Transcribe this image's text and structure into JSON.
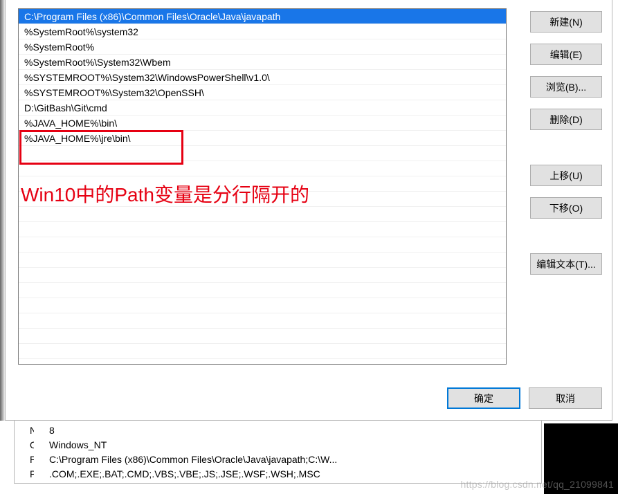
{
  "pathList": {
    "items": [
      "C:\\Program Files (x86)\\Common Files\\Oracle\\Java\\javapath",
      "%SystemRoot%\\system32",
      "%SystemRoot%",
      "%SystemRoot%\\System32\\Wbem",
      "%SYSTEMROOT%\\System32\\WindowsPowerShell\\v1.0\\",
      "%SYSTEMROOT%\\System32\\OpenSSH\\",
      "D:\\GitBash\\Git\\cmd",
      "%JAVA_HOME%\\bin\\",
      "%JAVA_HOME%\\jre\\bin\\"
    ],
    "selectedIndex": 0
  },
  "buttons": {
    "new": "新建(N)",
    "edit": "编辑(E)",
    "browse": "浏览(B)...",
    "delete": "删除(D)",
    "moveUp": "上移(U)",
    "moveDown": "下移(O)",
    "editText": "编辑文本(T)...",
    "ok": "确定",
    "cancel": "取消"
  },
  "annotation": {
    "text": "Win10中的Path变量是分行隔开的"
  },
  "backgroundVars": {
    "rows": [
      {
        "name": "NUMBER_OF_PROCESSORS",
        "value": "8"
      },
      {
        "name": "OS",
        "value": "Windows_NT"
      },
      {
        "name": "Path",
        "value": "C:\\Program Files (x86)\\Common Files\\Oracle\\Java\\javapath;C:\\W..."
      },
      {
        "name": "PATHEXT",
        "value": ".COM;.EXE;.BAT;.CMD;.VBS;.VBE;.JS;.JSE;.WSF;.WSH;.MSC"
      }
    ]
  },
  "watermark": "https://blog.csdn.net/qq_21099841"
}
